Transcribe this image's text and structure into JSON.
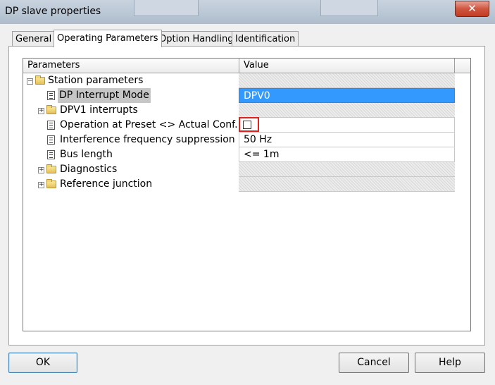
{
  "window": {
    "title": "DP slave properties",
    "close_glyph": "✕"
  },
  "tabs": [
    {
      "label": "General",
      "active": false
    },
    {
      "label": "Operating Parameters",
      "active": true
    },
    {
      "label": "Option Handling",
      "active": false
    },
    {
      "label": "Identification",
      "active": false
    }
  ],
  "grid": {
    "columns": [
      "Parameters",
      "Value"
    ],
    "rows": [
      {
        "label": "Station parameters",
        "icon": "folder-icon",
        "expander": "−",
        "value": "",
        "value_style": "hatch"
      },
      {
        "label": "DP Interrupt Mode",
        "icon": "parameter-icon",
        "value": "DPV0",
        "value_style": "selected"
      },
      {
        "label": "DPV1 interrupts",
        "icon": "folder-icon",
        "expander": "+",
        "value": "",
        "value_style": "hatch"
      },
      {
        "label": "Operation at Preset <> Actual Conf...",
        "icon": "parameter-icon",
        "value": "",
        "value_style": "checkbox",
        "checked": false
      },
      {
        "label": "Interference frequency suppression",
        "icon": "parameter-icon",
        "value": "50 Hz",
        "value_style": "white"
      },
      {
        "label": "Bus length",
        "icon": "parameter-icon",
        "value": "<= 1m",
        "value_style": "white"
      },
      {
        "label": "Diagnostics",
        "icon": "folder-icon",
        "expander": "+",
        "value": "",
        "value_style": "hatch"
      },
      {
        "label": "Reference junction",
        "icon": "folder-icon",
        "expander": "+",
        "value": "",
        "value_style": "hatch"
      }
    ]
  },
  "buttons": {
    "ok": "OK",
    "cancel": "Cancel",
    "help": "Help"
  },
  "colors": {
    "selection": "#3399ff",
    "highlight": "#e0221e",
    "close_button": "#c94a33"
  }
}
